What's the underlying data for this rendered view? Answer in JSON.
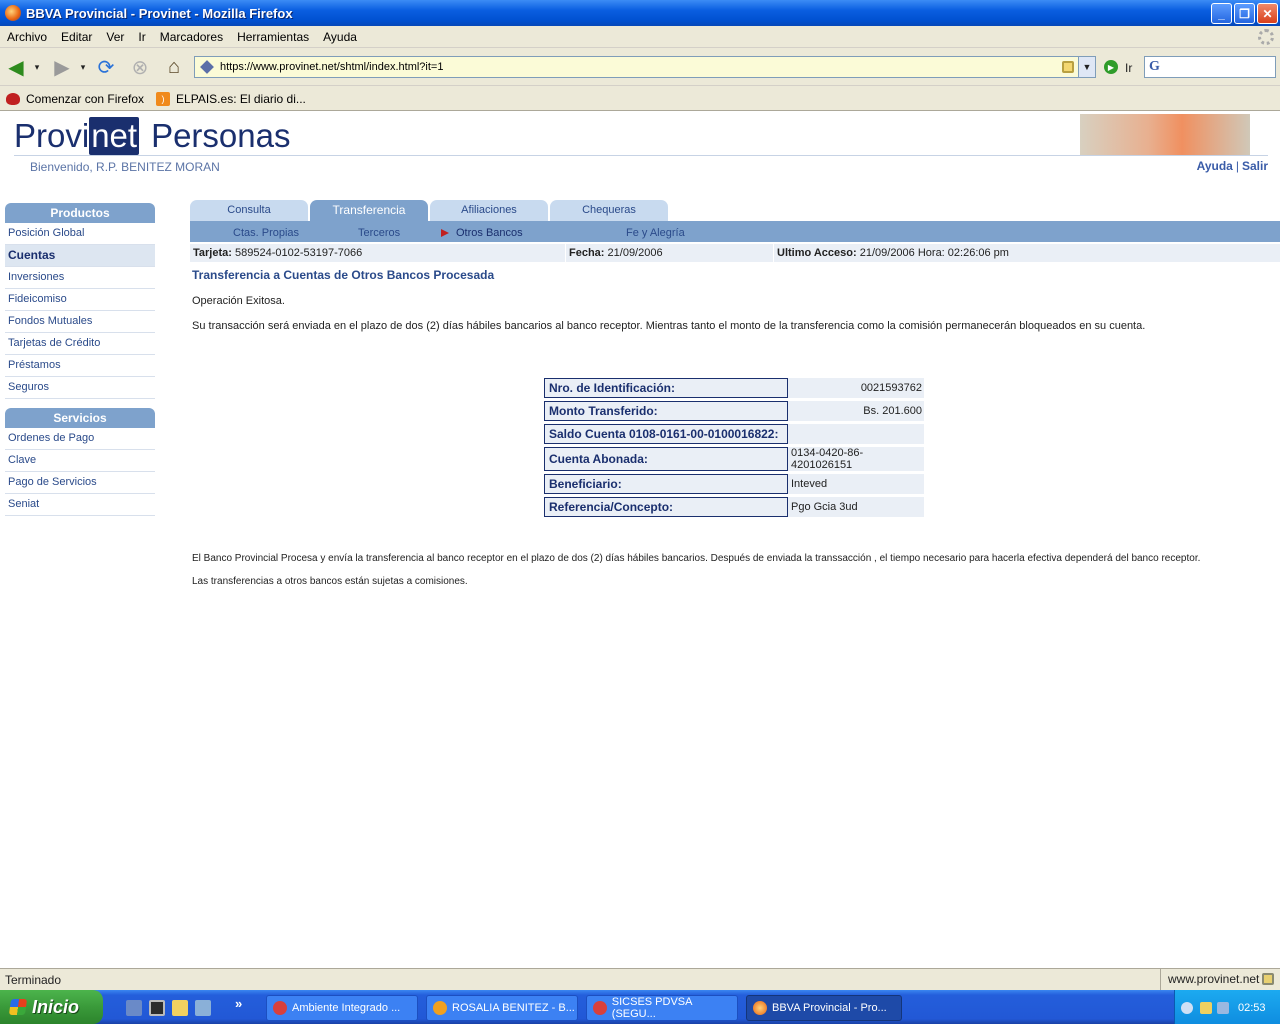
{
  "window": {
    "title": "BBVA Provincial - Provinet - Mozilla Firefox"
  },
  "menu": [
    "Archivo",
    "Editar",
    "Ver",
    "Ir",
    "Marcadores",
    "Herramientas",
    "Ayuda"
  ],
  "navbar": {
    "url": "https://www.provinet.net/shtml/index.html?it=1",
    "go_label": "Ir"
  },
  "bookmarks": [
    "Comenzar con Firefox",
    "ELPAIS.es: El diario di..."
  ],
  "header": {
    "logo_pre": "Provi",
    "logo_mid": "net",
    "logo_post": "Personas",
    "welcome": "Bienvenido, R.P. BENITEZ MORAN",
    "help": "Ayuda",
    "separator": "|",
    "logout": "Salir"
  },
  "sidebar": {
    "products_title": "Productos",
    "products": [
      "Posición Global",
      "Cuentas",
      "Inversiones",
      "Fideicomiso",
      "Fondos Mutuales",
      "Tarjetas de Crédito",
      "Préstamos",
      "Seguros"
    ],
    "services_title": "Servicios",
    "services": [
      "Ordenes de Pago",
      "Clave",
      "Pago de Servicios",
      "Seniat"
    ]
  },
  "tabs": [
    "Consulta",
    "Transferencia",
    "Afiliaciones",
    "Chequeras"
  ],
  "subtabs": [
    "Ctas. Propias",
    "Terceros",
    "Otros Bancos",
    "Fe y Alegría"
  ],
  "info": {
    "card_label": "Tarjeta:",
    "card_value": "589524-0102-53197-7066",
    "date_label": "Fecha:",
    "date_value": "21/09/2006",
    "access_label": "Ultimo Acceso:",
    "access_value": "21/09/2006 Hora: 02:26:06 pm"
  },
  "content": {
    "title": "Transferencia a Cuentas de Otros Bancos Procesada",
    "status": "Operación Exitosa.",
    "notice": "Su transacción será enviada en el plazo de dos (2) días hábiles bancarios al banco receptor. Mientras tanto el monto de la transferencia como la comisión permanecerán bloqueados en su cuenta.",
    "details": [
      {
        "label": "Nro. de Identificación:",
        "value": "0021593762"
      },
      {
        "label": "Monto Transferido:",
        "value": "Bs. 201.600"
      },
      {
        "label": "Saldo Cuenta 0108-0161-00-0100016822:",
        "value": ""
      },
      {
        "label": "Cuenta Abonada:",
        "value": "0134-0420-86-4201026151"
      },
      {
        "label": "Beneficiario:",
        "value": "Inteved"
      },
      {
        "label": "Referencia/Concepto:",
        "value": "Pgo Gcia 3ud"
      }
    ],
    "footer1": "El Banco Provincial Procesa y envía la transferencia al banco receptor en el plazo de dos (2) días hábiles bancarios. Después de enviada la transsacción , el tiempo necesario para hacerla efectiva dependerá del banco receptor.",
    "footer2": "Las transferencias a otros bancos están sujetas a comisiones."
  },
  "status": {
    "text": "Terminado",
    "site": "www.provinet.net"
  },
  "taskbar": {
    "start": "Inicio",
    "overflow": "»",
    "tasks": [
      "Ambiente Integrado ...",
      "ROSALIA BENITEZ - B...",
      "SICSES PDVSA (SEGU...",
      "BBVA Provincial - Pro..."
    ],
    "clock": "02:53"
  }
}
